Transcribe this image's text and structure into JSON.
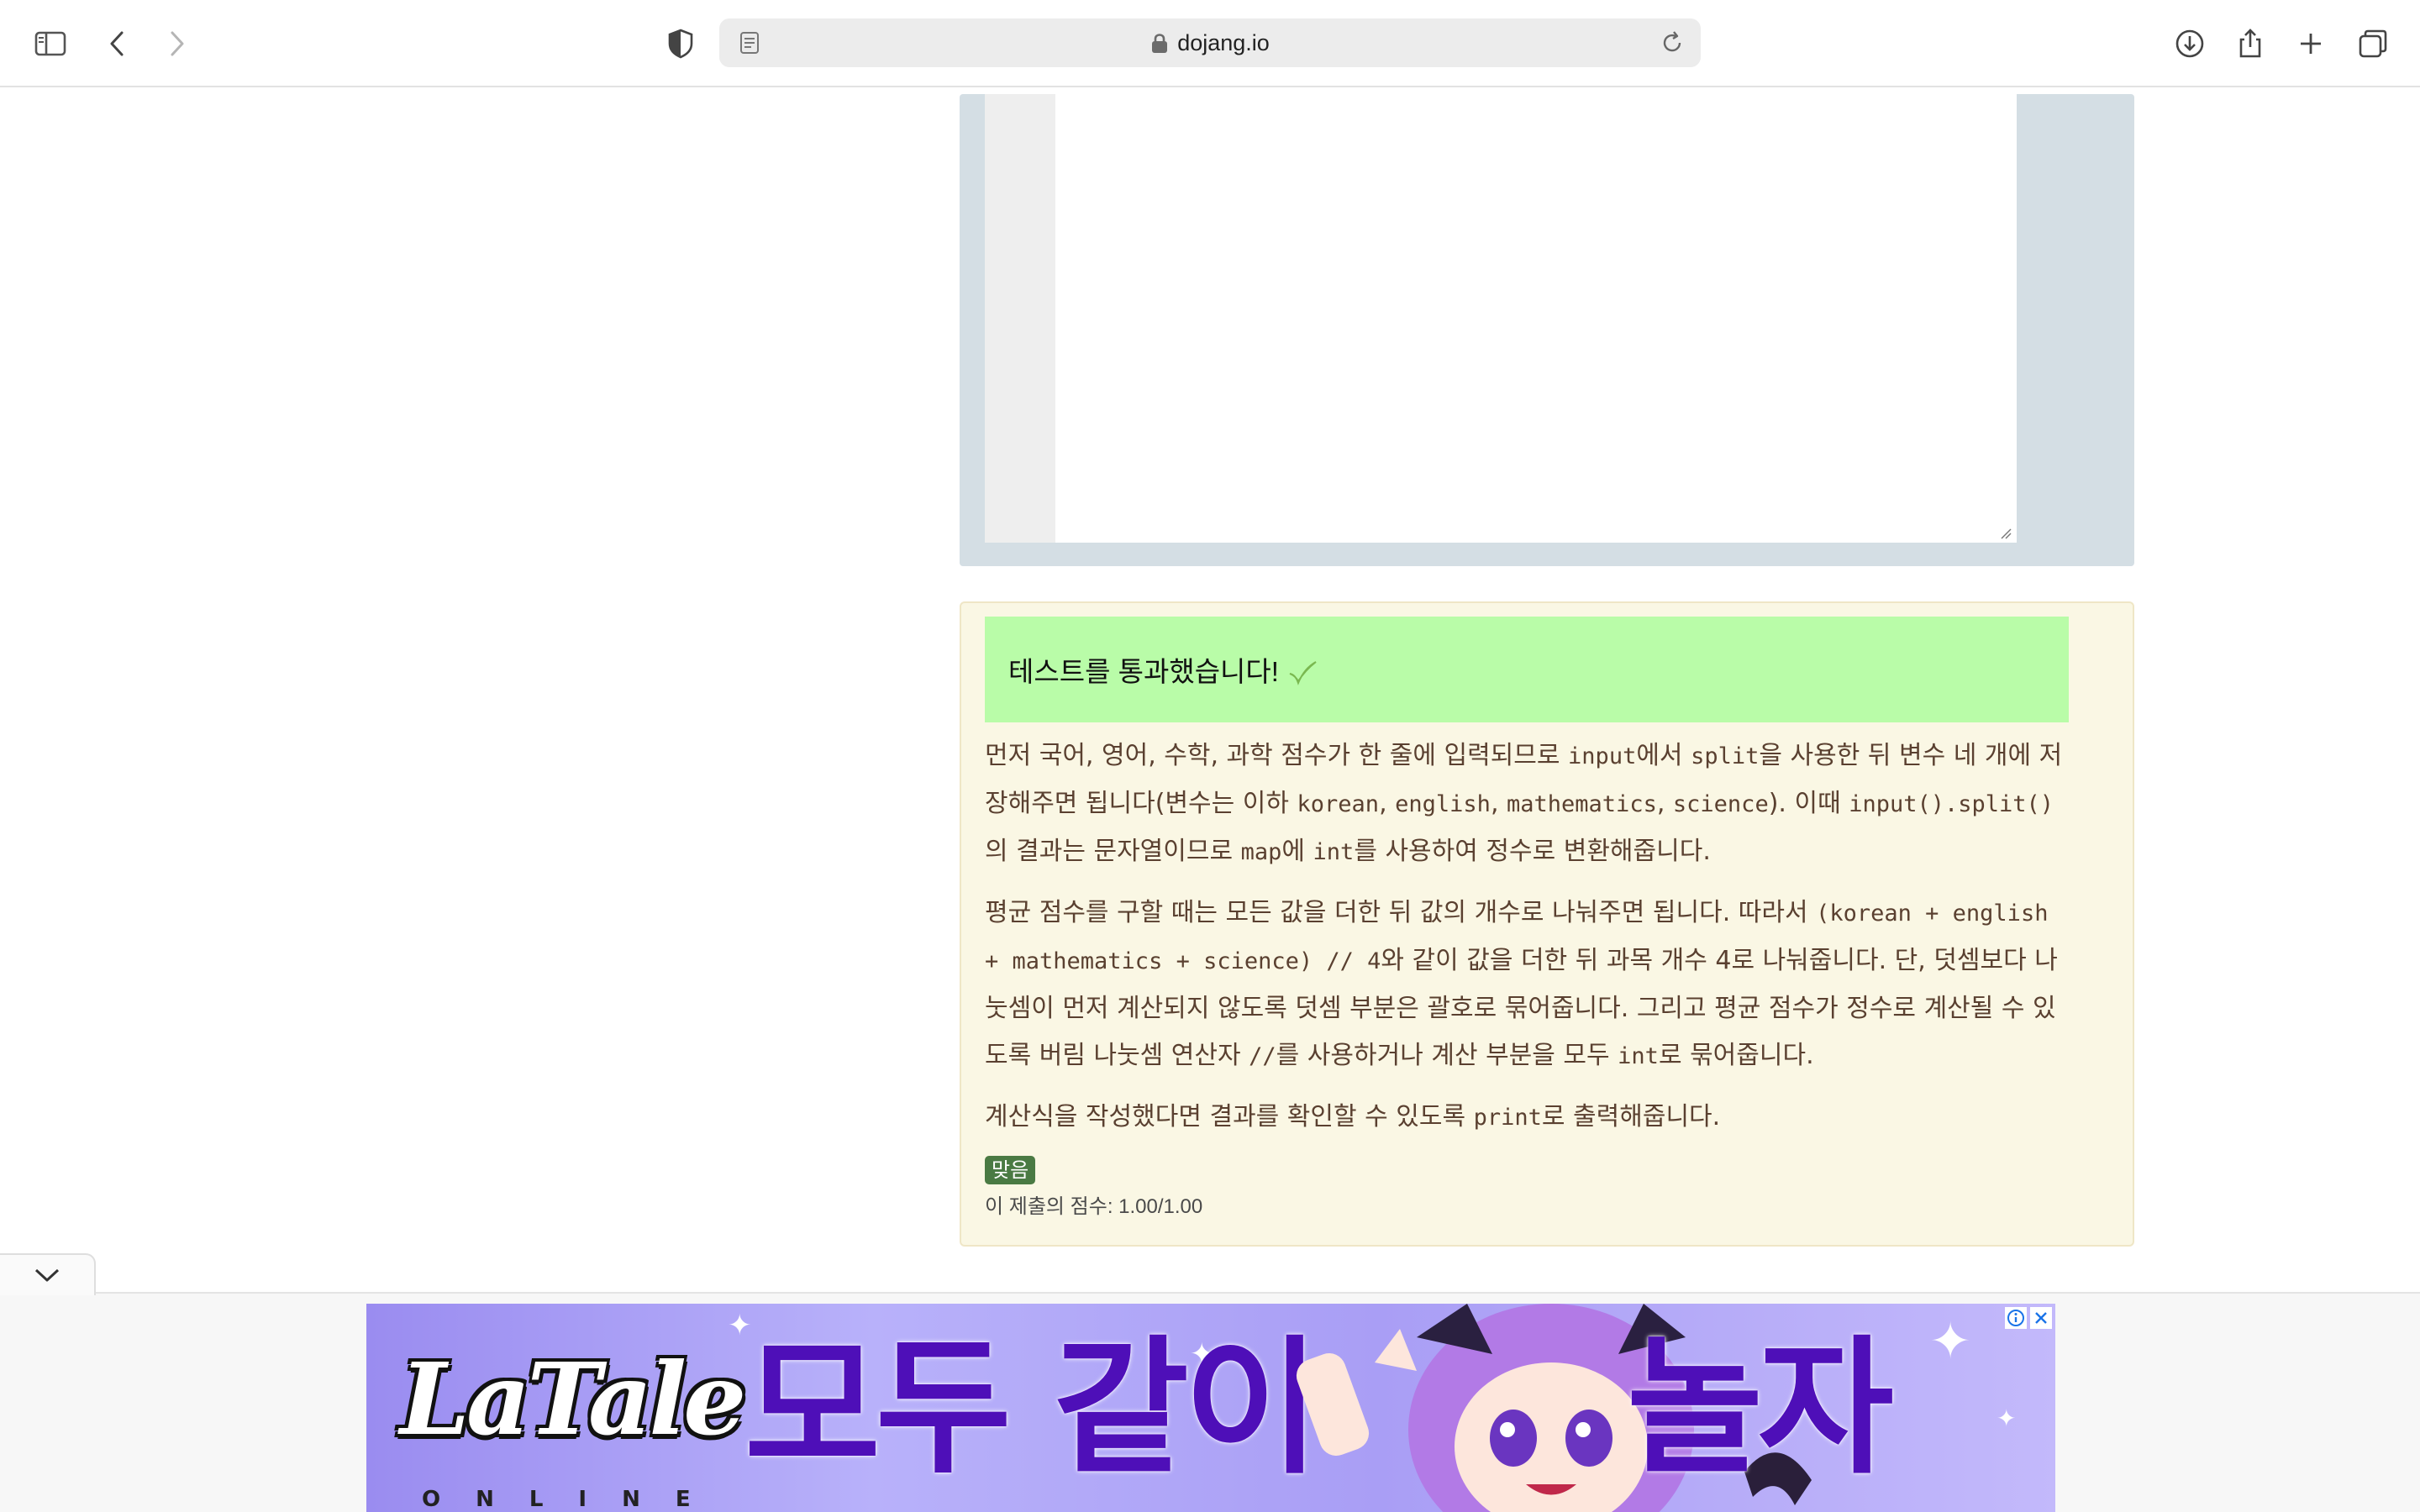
{
  "browser": {
    "url": "dojang.io"
  },
  "result": {
    "pass_message": "테스트를 통과했습니다!",
    "explanation": {
      "p1": [
        {
          "t": "text",
          "v": "먼저 국어, 영어, 수학, 과학 점수가 한 줄에 입력되므로 "
        },
        {
          "t": "code",
          "v": "input"
        },
        {
          "t": "text",
          "v": "에서 "
        },
        {
          "t": "code",
          "v": "split"
        },
        {
          "t": "text",
          "v": "을 사용한 뒤 변수 네 개에 저장해주면 됩니다(변수는 이하 "
        },
        {
          "t": "code",
          "v": "korean"
        },
        {
          "t": "text",
          "v": ", "
        },
        {
          "t": "code",
          "v": "english"
        },
        {
          "t": "text",
          "v": ", "
        },
        {
          "t": "code",
          "v": "mathematics"
        },
        {
          "t": "text",
          "v": ", "
        },
        {
          "t": "code",
          "v": "science"
        },
        {
          "t": "text",
          "v": "). 이때 "
        },
        {
          "t": "code",
          "v": "input().split()"
        },
        {
          "t": "text",
          "v": "의 결과는 문자열이므로 "
        },
        {
          "t": "code",
          "v": "map"
        },
        {
          "t": "text",
          "v": "에 "
        },
        {
          "t": "code",
          "v": "int"
        },
        {
          "t": "text",
          "v": "를 사용하여 정수로 변환해줍니다."
        }
      ],
      "p2": [
        {
          "t": "text",
          "v": "평균 점수를 구할 때는 모든 값을 더한 뒤 값의 개수로 나눠주면 됩니다. 따라서 "
        },
        {
          "t": "code",
          "v": "(korean + english + mathematics + science) // 4"
        },
        {
          "t": "text",
          "v": "와 같이 값을 더한 뒤 과목 개수 4로 나눠줍니다. 단, 덧셈보다 나눗셈이 먼저 계산되지 않도록 덧셈 부분은 괄호로 묶어줍니다. 그리고 평균 점수가 정수로 계산될 수 있도록 버림 나눗셈 연산자 "
        },
        {
          "t": "code",
          "v": "//"
        },
        {
          "t": "text",
          "v": "를 사용하거나 계산 부분을 모두 "
        },
        {
          "t": "code",
          "v": "int"
        },
        {
          "t": "text",
          "v": "로 묶어줍니다."
        }
      ],
      "p3": [
        {
          "t": "text",
          "v": "계산식을 작성했다면 결과를 확인할 수 있도록 "
        },
        {
          "t": "code",
          "v": "print"
        },
        {
          "t": "text",
          "v": "로 출력해줍니다."
        }
      ]
    },
    "badge": "맞음",
    "score": "이 제출의 점수: 1.00/1.00"
  },
  "ad": {
    "logo": "LaTale",
    "logo_sub": "ONLINE",
    "headline_1": "모두 같이",
    "headline_2": "놀자"
  },
  "colors": {
    "pass_banner": "#b9fca8",
    "panel_bg": "#faf7e4",
    "badge_bg": "#4a7a43",
    "editor_frame": "#d4dee4"
  },
  "icons": [
    "sidebar-icon",
    "back-icon",
    "forward-icon",
    "privacy-shield-icon",
    "reader-icon",
    "lock-icon",
    "reload-icon",
    "download-icon",
    "share-icon",
    "new-tab-icon",
    "tab-overview-icon",
    "checkmark-icon",
    "chevron-down-icon",
    "ad-info-icon",
    "ad-close-icon"
  ]
}
